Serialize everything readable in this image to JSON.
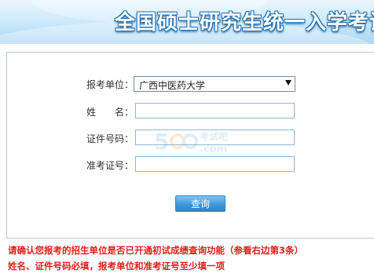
{
  "banner": {
    "title": "全国硕士研究生统一入学考试"
  },
  "form": {
    "unit_label": "报考单位：",
    "unit_selected": "广西中医药大学",
    "name_label": "姓　　名：",
    "name_value": "",
    "id_label": "证件号码：",
    "id_value": "",
    "ticket_label": "准考证号：",
    "ticket_value": "",
    "submit_label": "查询"
  },
  "notices": {
    "line1": "请确认您报考的招生单位是否已开通初试成绩查询功能（参看右边第3条）",
    "line2": "姓名、证件号码必填，报考单位和准考证号至少填一项"
  },
  "colors": {
    "notice": "#e0211b",
    "button": "#3f98dc",
    "banner": "#a9d7f4"
  }
}
